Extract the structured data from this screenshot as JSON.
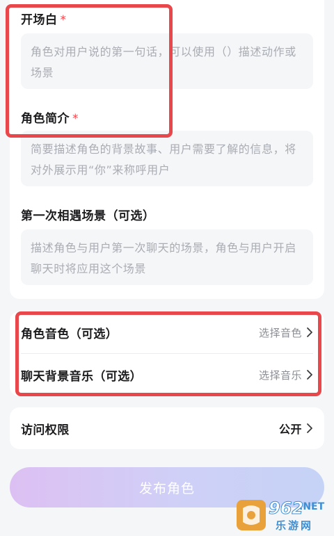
{
  "form": {
    "opening": {
      "label": "开场白",
      "required_mark": "*",
      "placeholder": "角色对用户说的第一句话，可以使用（）描述动作或场景"
    },
    "intro": {
      "label": "角色简介",
      "required_mark": "*",
      "placeholder": "简要描述角色的背景故事、用户需要了解的信息，将对外展示用“你”来称呼用户"
    },
    "first_meet": {
      "label": "第一次相遇场景（可选）",
      "placeholder": "描述角色与用户第一次聊天的场景，角色与用户开启聊天时将应用这个场景"
    }
  },
  "settings": {
    "voice": {
      "label": "角色音色（可选）",
      "value": "选择音色"
    },
    "music": {
      "label": "聊天背景音乐（可选）",
      "value": "选择音乐"
    },
    "access": {
      "label": "访问权限",
      "value": "公开"
    }
  },
  "publish_button": {
    "label": "发布角色"
  },
  "watermark": {
    "number": "962",
    "domain": ".NET",
    "site": "乐游网"
  },
  "colors": {
    "accent_red": "#e8474b",
    "required_star": "#f0474d",
    "button_gradient_start": "#ddc0f3",
    "button_gradient_end": "#c5d3f6"
  },
  "icons": {
    "row_arrow": "chevron-right-icon",
    "watermark_logo": "962-logo-icon"
  }
}
